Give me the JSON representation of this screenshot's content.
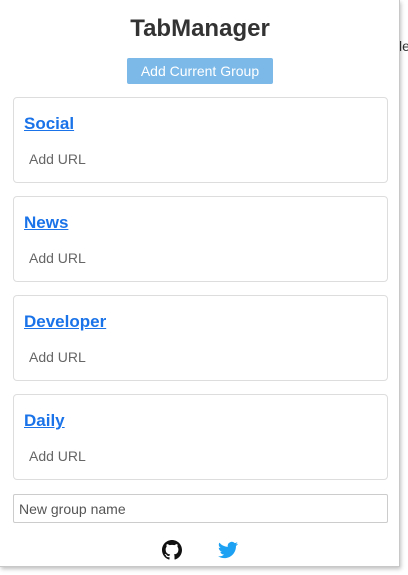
{
  "background": {
    "cutoff_text": "le"
  },
  "popup": {
    "title": "TabManager",
    "add_group_label": "Add Current Group",
    "accent_color": "#7cb9e8",
    "link_color": "#1a73e8"
  },
  "groups": [
    {
      "name": "Social",
      "add_url_label": "Add URL"
    },
    {
      "name": "News",
      "add_url_label": "Add URL"
    },
    {
      "name": "Developer",
      "add_url_label": "Add URL"
    },
    {
      "name": "Daily",
      "add_url_label": "Add URL"
    }
  ],
  "new_group": {
    "placeholder": "New group name",
    "value": ""
  },
  "footer": {
    "icons": [
      "github-icon",
      "twitter-icon"
    ]
  }
}
